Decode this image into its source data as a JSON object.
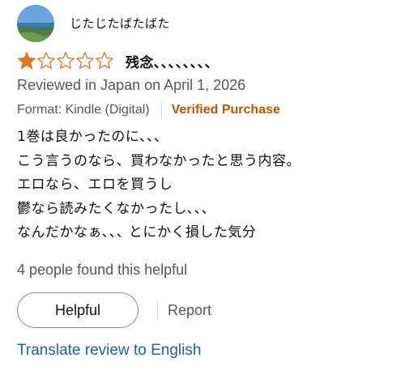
{
  "reviewer": {
    "name": "じたじたばたばた",
    "avatar_icon": "avatar-landscape-photo"
  },
  "review": {
    "rating": 1,
    "max_rating": 5,
    "star_color": "#de7921",
    "title": "残念､､､､､､､､",
    "date_line": "Reviewed in Japan on April 1, 2026",
    "format": "Format: Kindle (Digital)",
    "verified": "Verified Purchase",
    "body_lines": [
      "1巻は良かったのに､､､",
      "こう言うのなら、買わなかったと思う内容。",
      "エロなら、エロを買うし",
      "鬱なら読みたくなかったし､､､",
      "なんだかなぁ､､､ とにかく損した気分"
    ]
  },
  "feedback": {
    "helpful_count_text": "4 people found this helpful",
    "helpful_label": "Helpful",
    "report_label": "Report",
    "translate_label": "Translate review to English"
  },
  "colors": {
    "verified": "#c45500",
    "link": "#2162a1",
    "muted": "#565959"
  }
}
